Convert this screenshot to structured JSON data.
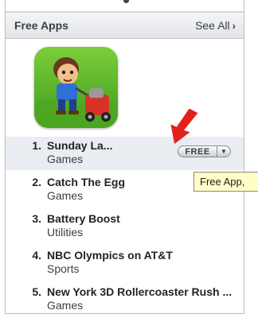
{
  "section": {
    "title": "Free Apps",
    "see_all_label": "See All"
  },
  "featured_app": {
    "icon": "lawn-mower-boy-game-icon"
  },
  "buttons": {
    "free_label": "FREE"
  },
  "tooltip": {
    "text": "Free App,"
  },
  "apps": [
    {
      "rank": "1.",
      "name": "Sunday La...",
      "category": "Games"
    },
    {
      "rank": "2.",
      "name": "Catch The Egg",
      "category": "Games"
    },
    {
      "rank": "3.",
      "name": "Battery Boost",
      "category": "Utilities"
    },
    {
      "rank": "4.",
      "name": "NBC Olympics on AT&T",
      "category": "Sports"
    },
    {
      "rank": "5.",
      "name": "New York 3D Rollercoaster Rush ...",
      "category": "Games"
    }
  ],
  "colors": {
    "arrow": "#e3201b",
    "tooltip_bg": "#fffec8",
    "selected_row": "#e9ecf1"
  }
}
